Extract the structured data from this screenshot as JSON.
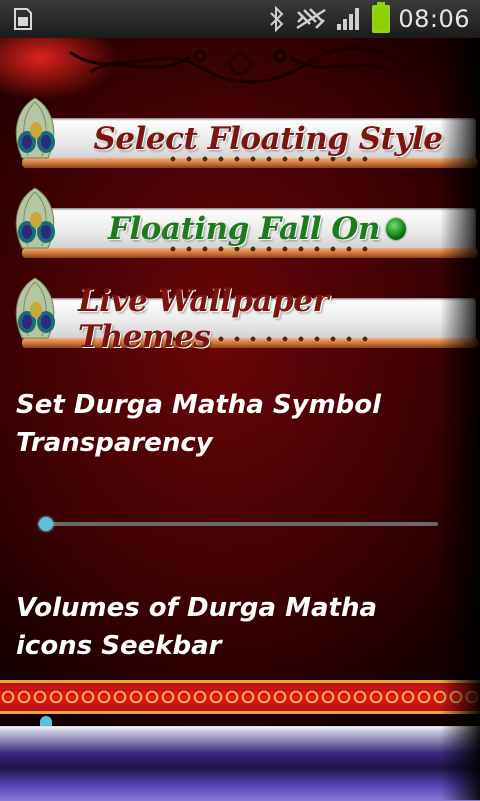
{
  "status_bar": {
    "time": "08:06",
    "icons": [
      "sim-card-icon",
      "bluetooth-icon",
      "mute-icon",
      "signal-icon",
      "battery-icon"
    ],
    "battery_color": "#8dd100"
  },
  "menu": {
    "items": [
      {
        "label": "Select Floating Style",
        "color": "#7c1410"
      },
      {
        "label": "Floating Fall  On",
        "color": "#1d7a1d",
        "toggle_on": true
      },
      {
        "label": "Live Wallpaper  Themes",
        "color": "#7c1410"
      }
    ]
  },
  "preferences": {
    "transparency": {
      "title": "Set Durga Matha Symbol Transparency",
      "value_percent": 0
    },
    "volume": {
      "title": "Volumes of Durga Matha icons Seekbar",
      "value_percent": 0
    }
  },
  "colors": {
    "accent": "#33b5e5",
    "background": "#4a0206",
    "divider_red": "#e0181b",
    "divider_gold": "#f3cf5b"
  }
}
